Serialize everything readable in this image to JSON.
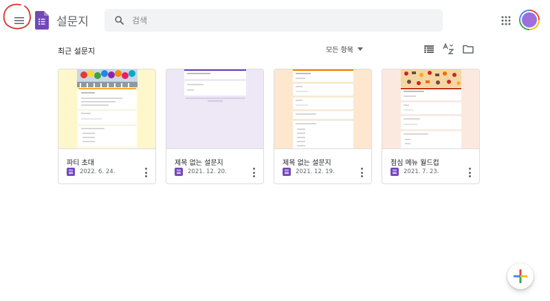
{
  "header": {
    "app_title": "설문지",
    "search_placeholder": "검색"
  },
  "section": {
    "title": "최근 설문지",
    "sort_label": "모든 항목"
  },
  "icons": {
    "menu": "hamburger-menu-icon",
    "search": "search-icon",
    "apps": "google-apps-grid-icon",
    "list_view": "list-view-icon",
    "sort": "sort-az-icon",
    "folder": "folder-icon",
    "more": "more-vert-icon",
    "fab": "plus-icon"
  },
  "colors": {
    "forms_purple": "#7248b9",
    "annotation_red": "#d93025",
    "card_border": "#dadce0"
  },
  "cards": [
    {
      "title": "파티 초대",
      "date": "2022. 6. 24.",
      "thumb_bg": "#fff7cc"
    },
    {
      "title": "제목 없는 설문지",
      "date": "2021. 12. 20.",
      "thumb_bg": "#ede7f6"
    },
    {
      "title": "제목 없는 설문지",
      "date": "2021. 12. 19.",
      "thumb_bg": "#fde7cf"
    },
    {
      "title": "점심 메뉴 월드컵",
      "date": "2021. 7. 23.",
      "thumb_bg": "#fbe9e0"
    }
  ]
}
